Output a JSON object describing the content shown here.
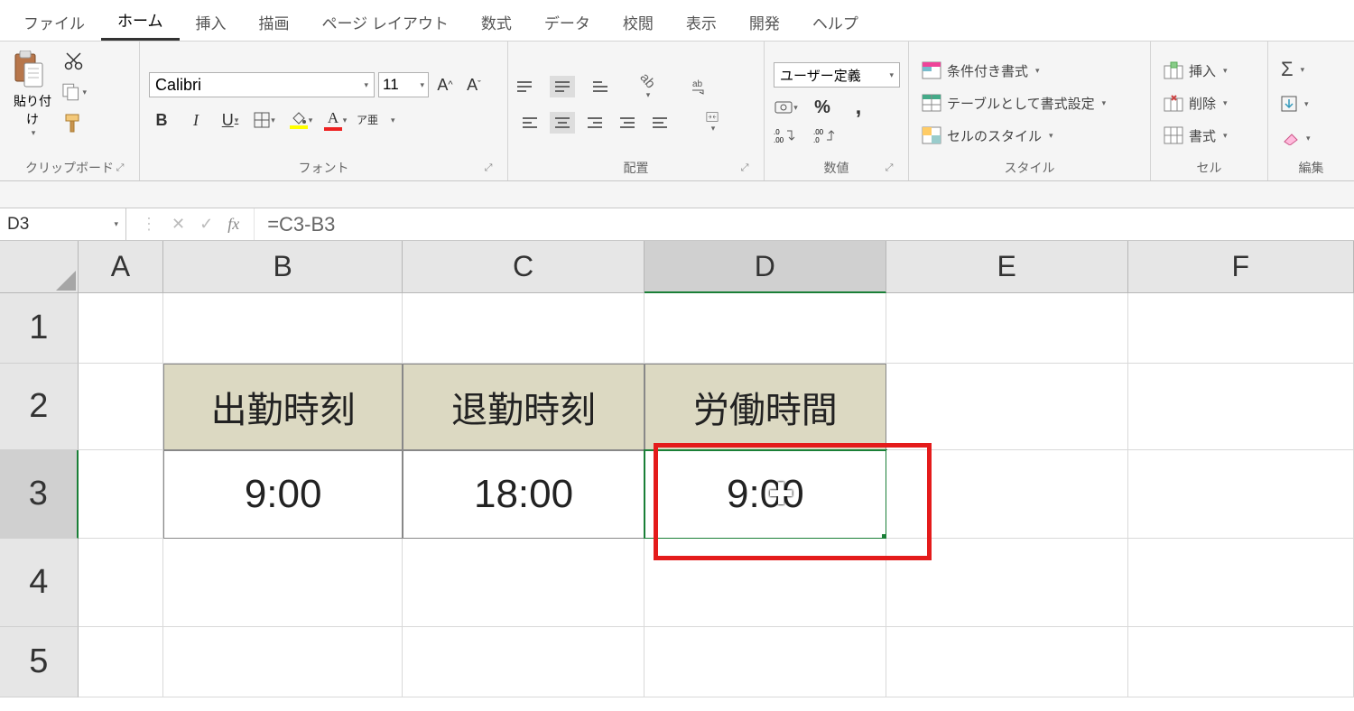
{
  "menu": {
    "tabs": [
      "ファイル",
      "ホーム",
      "挿入",
      "描画",
      "ページ レイアウト",
      "数式",
      "データ",
      "校閲",
      "表示",
      "開発",
      "ヘルプ"
    ],
    "active_index": 1
  },
  "ribbon": {
    "clipboard": {
      "paste": "貼り付け",
      "label": "クリップボード"
    },
    "font": {
      "name": "Calibri",
      "size": "11",
      "bold": "B",
      "italic": "I",
      "underline": "U",
      "ruby": "ア亜",
      "label": "フォント"
    },
    "alignment": {
      "wrap": "ab",
      "label": "配置"
    },
    "number": {
      "format": "ユーザー定義",
      "percent": "%",
      "comma": "ᵒ",
      "inc": ".0→.00",
      "dec": ".00→.0",
      "label": "数値"
    },
    "styles": {
      "cond": "条件付き書式",
      "table": "テーブルとして書式設定",
      "cell": "セルのスタイル",
      "label": "スタイル"
    },
    "cells": {
      "insert": "挿入",
      "delete": "削除",
      "format": "書式",
      "label": "セル"
    },
    "editing": {
      "label": "編集"
    }
  },
  "nameBox": "D3",
  "formula": "=C3-B3",
  "fx": "fx",
  "cols": [
    "A",
    "B",
    "C",
    "D",
    "E",
    "F"
  ],
  "rows": [
    "1",
    "2",
    "3",
    "4",
    "5"
  ],
  "sheet": {
    "B2": "出勤時刻",
    "C2": "退勤時刻",
    "D2": "労働時間",
    "B3": "9:00",
    "C3": "18:00",
    "D3": "9:00"
  },
  "selected": {
    "col": "D",
    "row": "3"
  }
}
